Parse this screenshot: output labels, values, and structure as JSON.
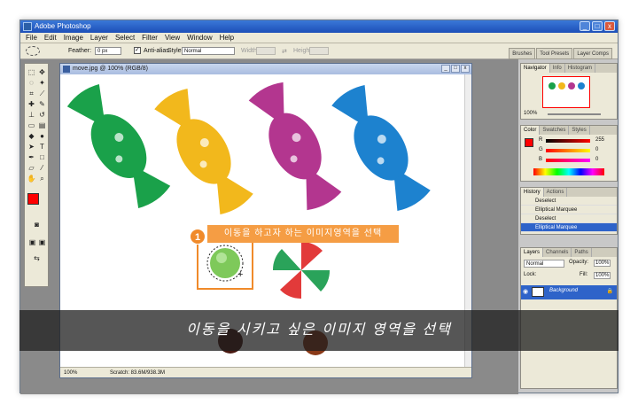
{
  "window": {
    "title": "Adobe Photoshop",
    "min": "_",
    "max": "□",
    "close": "x"
  },
  "menu": [
    "File",
    "Edit",
    "Image",
    "Layer",
    "Select",
    "Filter",
    "View",
    "Window",
    "Help"
  ],
  "options": {
    "feather_label": "Feather:",
    "feather_value": "0 px",
    "antialias_label": "Anti-alias",
    "style_label": "Style:",
    "style_value": "Normal",
    "width_label": "Width:",
    "height_label": "Height:",
    "palette_well": [
      "Brushes",
      "Tool Presets",
      "Layer Comps"
    ]
  },
  "document": {
    "title": "move.jpg @ 100% (RGB/8)",
    "zoom": "100%",
    "scratch": "Scratch: 83.6M/938.3M"
  },
  "navigator": {
    "tabs": [
      "Navigator",
      "Info",
      "Histogram"
    ],
    "zoom": "100%"
  },
  "color": {
    "tabs": [
      "Color",
      "Swatches",
      "Styles"
    ],
    "r_label": "R",
    "g_label": "G",
    "b_label": "B",
    "r": "255",
    "g": "0",
    "b": "0",
    "foreground": "#ff0000"
  },
  "history": {
    "tabs": [
      "History",
      "Actions"
    ],
    "items": [
      "Deselect",
      "Elliptical Marquee",
      "Deselect",
      "Elliptical Marquee"
    ],
    "selected_index": 3
  },
  "layers": {
    "tabs": [
      "Layers",
      "Channels",
      "Paths"
    ],
    "blend": "Normal",
    "opacity_label": "Opacity:",
    "opacity": "100%",
    "lock_label": "Lock:",
    "fill_label": "Fill:",
    "fill": "100%",
    "layer_name": "Background"
  },
  "callout": {
    "number": "1",
    "text": "이동을 하고자 하는 이미지영역을 선택"
  },
  "subtitle": "이동을 시키고 싶은 이미지 영역을 선택",
  "candies": [
    "green",
    "yellow",
    "purple",
    "blue"
  ],
  "candy_colors": [
    "#1aa14a",
    "#f2b81c",
    "#b3368f",
    "#1d82cf"
  ],
  "accent": "#f59d44"
}
